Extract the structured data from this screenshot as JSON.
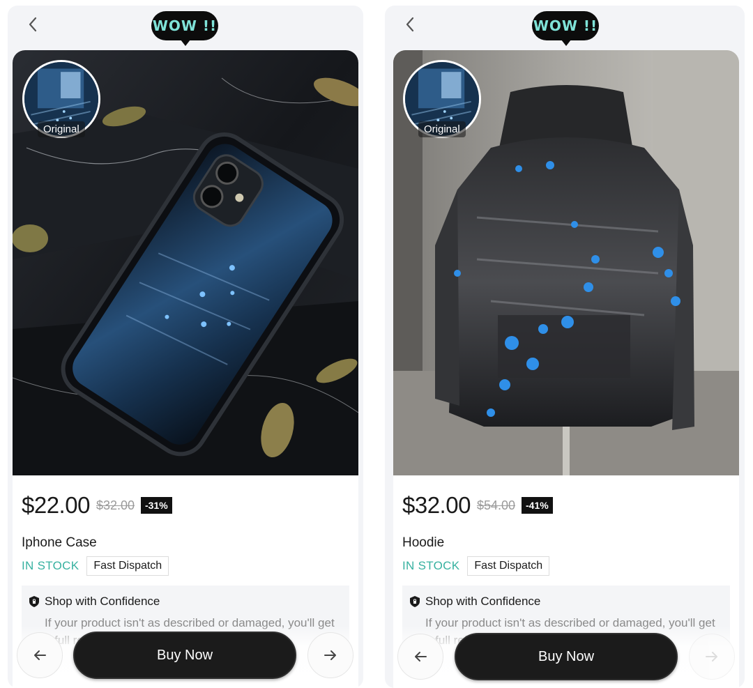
{
  "screens": [
    {
      "wow_label": "WOW !!",
      "original_label": "Original",
      "product": {
        "price": "$22.00",
        "old_price": "$32.00",
        "discount": "-31%",
        "title": "Iphone Case",
        "stock": "IN STOCK",
        "dispatch": "Fast Dispatch"
      },
      "confidence": {
        "heading": "Shop with Confidence",
        "text": "If your product isn't as described or damaged, you'll get a full refund."
      },
      "buy_label": "Buy Now",
      "icons": {
        "back": "chevron-left-icon",
        "prev": "arrow-left-icon",
        "next": "arrow-right-icon",
        "shield": "shield-icon"
      }
    },
    {
      "wow_label": "WOW !!",
      "original_label": "Original",
      "product": {
        "price": "$32.00",
        "old_price": "$54.00",
        "discount": "-41%",
        "title": "Hoodie",
        "stock": "IN STOCK",
        "dispatch": "Fast Dispatch"
      },
      "confidence": {
        "heading": "Shop with Confidence",
        "text": "If your product isn't as described or damaged, you'll get a full refund."
      },
      "buy_label": "Buy Now",
      "icons": {
        "back": "chevron-left-icon",
        "prev": "arrow-left-icon",
        "next": "arrow-right-icon",
        "shield": "shield-icon"
      }
    }
  ],
  "colors": {
    "wow_text": "#7fe3d8",
    "stock_text": "#37b1a0",
    "buy_button": "#1b1b1b",
    "discount_badge": "#111111"
  }
}
